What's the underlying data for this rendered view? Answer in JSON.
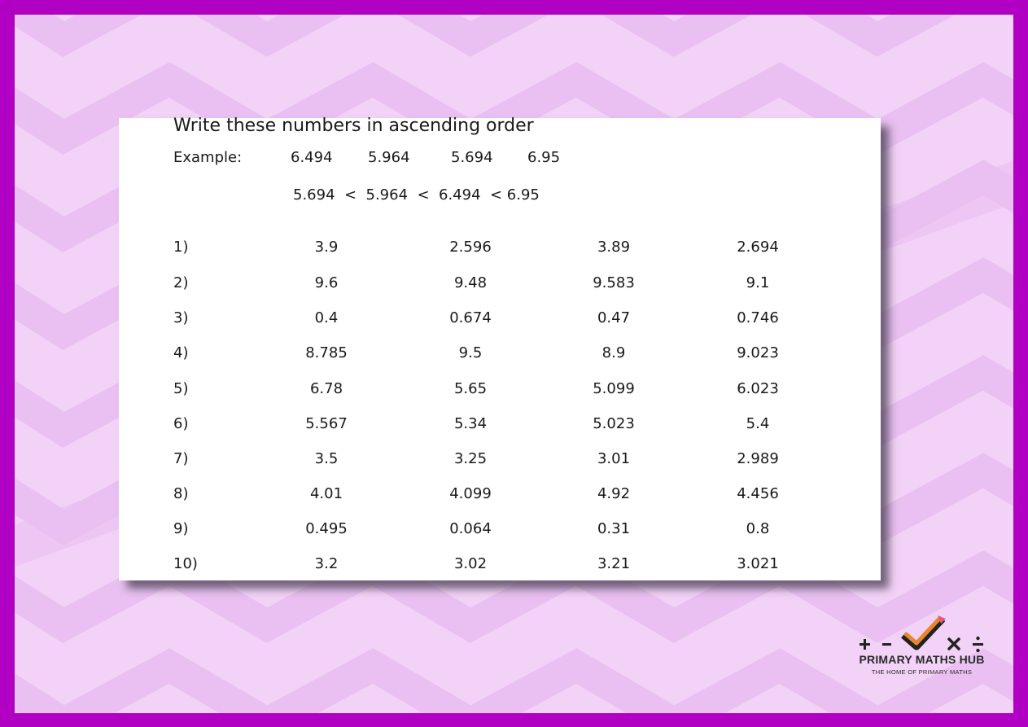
{
  "worksheet": {
    "title": "Write these numbers in ascending order",
    "example": {
      "label": "Example:",
      "numbers": [
        "6.494",
        "5.964",
        "5.694",
        "6.95"
      ],
      "answer": "5.694  <  5.964  <  6.494  < 6.95"
    },
    "questions": [
      {
        "label": "1)",
        "values": [
          "3.9",
          "2.596",
          "3.89",
          "2.694"
        ]
      },
      {
        "label": "2)",
        "values": [
          "9.6",
          "9.48",
          "9.583",
          "9.1"
        ]
      },
      {
        "label": "3)",
        "values": [
          "0.4",
          "0.674",
          "0.47",
          "0.746"
        ]
      },
      {
        "label": "4)",
        "values": [
          "8.785",
          "9.5",
          "8.9",
          "9.023"
        ]
      },
      {
        "label": "5)",
        "values": [
          "6.78",
          "5.65",
          "5.099",
          "6.023"
        ]
      },
      {
        "label": "6)",
        "values": [
          "5.567",
          "5.34",
          "5.023",
          "5.4"
        ]
      },
      {
        "label": "7)",
        "values": [
          "3.5",
          "3.25",
          "3.01",
          "2.989"
        ]
      },
      {
        "label": "8)",
        "values": [
          "4.01",
          "4.099",
          "4.92",
          "4.456"
        ]
      },
      {
        "label": "9)",
        "values": [
          "0.495",
          "0.064",
          "0.31",
          "0.8"
        ]
      },
      {
        "label": "10)",
        "values": [
          "3.2",
          "3.02",
          "3.21",
          "3.021"
        ]
      }
    ]
  },
  "logo": {
    "name": "PRIMARY MATHS HUB",
    "tagline": "THE HOME OF PRIMARY MATHS"
  },
  "colors": {
    "border": "#b100c4",
    "background": "#f2d2f6",
    "chevron": "#e9bff0",
    "sheet": "#ffffff",
    "logo_check": "#e8862f"
  }
}
